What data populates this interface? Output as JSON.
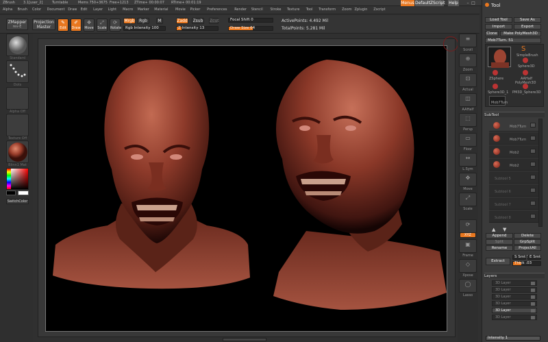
{
  "title_bar": {
    "app": "ZBrush",
    "version": "3.1[user_2]",
    "mode": "Turntable",
    "mem": "Mems 750+3675",
    "free": "Free+1213",
    "ztime": "ZTime+ 00:00:07",
    "rtime": "RTime+ 00:01:19",
    "menus_label": "Menus",
    "script_label": "DefaultZScript",
    "help_label": "Help"
  },
  "menus": [
    "Alpha",
    "Brush",
    "Color",
    "Document",
    "Draw",
    "Edit",
    "Layer",
    "Light",
    "Macro",
    "Marker",
    "Material",
    "Movie",
    "Picker",
    "Preferences",
    "Render",
    "Stencil",
    "Stroke",
    "Texture",
    "Tool",
    "Transform",
    "Zoom",
    "Zplugin",
    "Zscript"
  ],
  "toolbar": {
    "zmapper": "ZMapper",
    "zmapper_rev": "rev-E",
    "projection": "Projection",
    "projection_sub": "Master",
    "edit": "Edit",
    "draw": "Draw",
    "move": "Move",
    "scale": "Scale",
    "rotate": "Rotate",
    "mrgb": "Mrgb",
    "rgb": "Rgb",
    "m": "M",
    "rgb_intensity": "Rgb Intensity 100",
    "zadd": "Zadd",
    "zsub": "Zsub",
    "z_intensity": "Z Intensity 13",
    "zcut": "Zcut",
    "focal_shift": "Focal Shift 0",
    "draw_size": "Draw Size 64",
    "active_points": "ActivePoints: 4.492 Mil",
    "total_points": "TotalPoints: 5.281 Mil"
  },
  "left_shelf": {
    "items": [
      "Standard",
      "Dots",
      "Alpha Off",
      "Texture Off",
      "Blinn1 Mat"
    ],
    "switch_color": "SwitchColor"
  },
  "right_shelf": {
    "items": [
      "Scroll",
      "Zoom",
      "Actual",
      "AAHalf",
      "Persp",
      "Floor",
      "L.Sym",
      "Move",
      "Scale",
      "Rotate",
      "Frame",
      "Xpose",
      "Lasso"
    ],
    "xyz_label": "XYZ"
  },
  "tool_panel": {
    "header": "Tool",
    "load_tool": "Load Tool",
    "save_as": "Save As",
    "import": "Import",
    "export": "Export",
    "clone": "Clone",
    "make_polymesh": "Make PolyMesh3D",
    "current_tool": "Mob7Turn. 51",
    "tool_items": [
      "Mob7Turn",
      "SimpleBrush",
      "ZSphere",
      "Sphere3D",
      "AAHalf",
      "PolyMesh3D",
      "Sphere3D_1",
      "PM3D_Sphere3D",
      "Mob7Turn"
    ],
    "subtool_label": "SubTool",
    "subtools": [
      "Mob7Turn",
      "Mob7Turn",
      "Mob2",
      "Mob2",
      "Subtool 5",
      "Subtool 6",
      "Subtool 7",
      "Subtool 8"
    ],
    "append": "Append",
    "delete": "Delete",
    "split": "Split",
    "grp_split": "GrpSplit",
    "rename": "Rename",
    "project_all": "ProjectAll",
    "extract": "Extract",
    "smt": "S Smt 5",
    "smt2": "E Smt",
    "thick": "Thick .03",
    "layers_label": "Layers",
    "layers": [
      "3D Layer",
      "3D Layer",
      "3D Layer",
      "3D Layer",
      "3D Layer",
      "3D Layer"
    ],
    "intensity": "Intensity 1"
  },
  "colors": {
    "accent": "#e8771f",
    "skin": "#8a3b2c",
    "background": "#000000"
  }
}
